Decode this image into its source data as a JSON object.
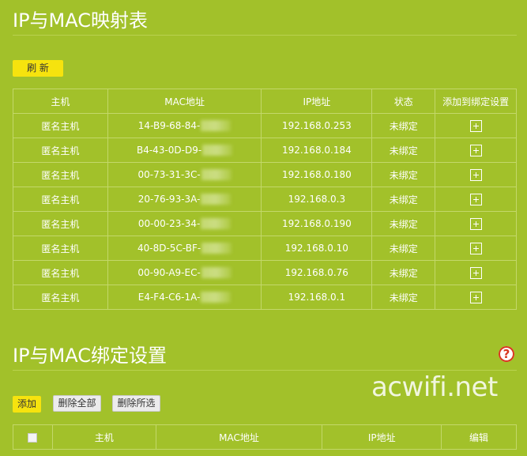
{
  "section1": {
    "title": "IP与MAC映射表",
    "refresh_label": "刷 新",
    "columns": [
      "主机",
      "MAC地址",
      "IP地址",
      "状态",
      "添加到绑定设置"
    ],
    "rows": [
      {
        "host": "匿名主机",
        "mac": "14-B9-68-84-",
        "ip": "192.168.0.253",
        "status": "未绑定"
      },
      {
        "host": "匿名主机",
        "mac": "B4-43-0D-D9-",
        "ip": "192.168.0.184",
        "status": "未绑定"
      },
      {
        "host": "匿名主机",
        "mac": "00-73-31-3C-",
        "ip": "192.168.0.180",
        "status": "未绑定"
      },
      {
        "host": "匿名主机",
        "mac": "20-76-93-3A-",
        "ip": "192.168.0.3",
        "status": "未绑定"
      },
      {
        "host": "匿名主机",
        "mac": "00-00-23-34-",
        "ip": "192.168.0.190",
        "status": "未绑定"
      },
      {
        "host": "匿名主机",
        "mac": "40-8D-5C-BF-",
        "ip": "192.168.0.10",
        "status": "未绑定"
      },
      {
        "host": "匿名主机",
        "mac": "00-90-A9-EC-",
        "ip": "192.168.0.76",
        "status": "未绑定"
      },
      {
        "host": "匿名主机",
        "mac": "E4-F4-C6-1A-",
        "ip": "192.168.0.1",
        "status": "未绑定"
      }
    ]
  },
  "section2": {
    "title": "IP与MAC绑定设置",
    "add_label": "添加",
    "delete_all_label": "删除全部",
    "delete_selected_label": "删除所选",
    "columns": [
      "主机",
      "MAC地址",
      "IP地址",
      "编辑"
    ],
    "help_symbol": "?"
  },
  "watermark": "acwifi.net"
}
